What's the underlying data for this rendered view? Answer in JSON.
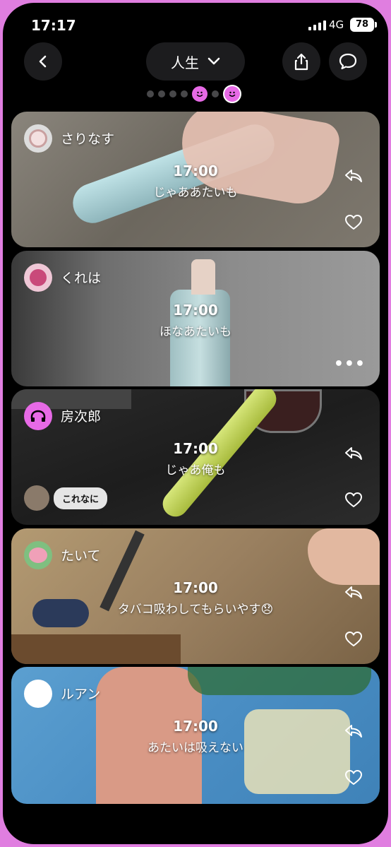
{
  "status": {
    "time": "17:17",
    "network": "4G",
    "battery": "78"
  },
  "header": {
    "title": "人生"
  },
  "posts": [
    {
      "user": "さりなす",
      "time": "17:00",
      "message": "じゃああたいも"
    },
    {
      "user": "くれは",
      "time": "17:00",
      "message": "ほなあたいも"
    },
    {
      "user": "房次郎",
      "time": "17:00",
      "message": "じゃあ俺も",
      "comment": "これなに"
    },
    {
      "user": "たいて",
      "time": "17:00",
      "message": "タバコ吸わしてもらいやす😞"
    },
    {
      "user": "ルアン",
      "time": "17:00",
      "message": "あたいは吸えない"
    }
  ],
  "colors": {
    "accent": "#e76ae6",
    "background": "#000000",
    "frame": "#e07ee0"
  }
}
